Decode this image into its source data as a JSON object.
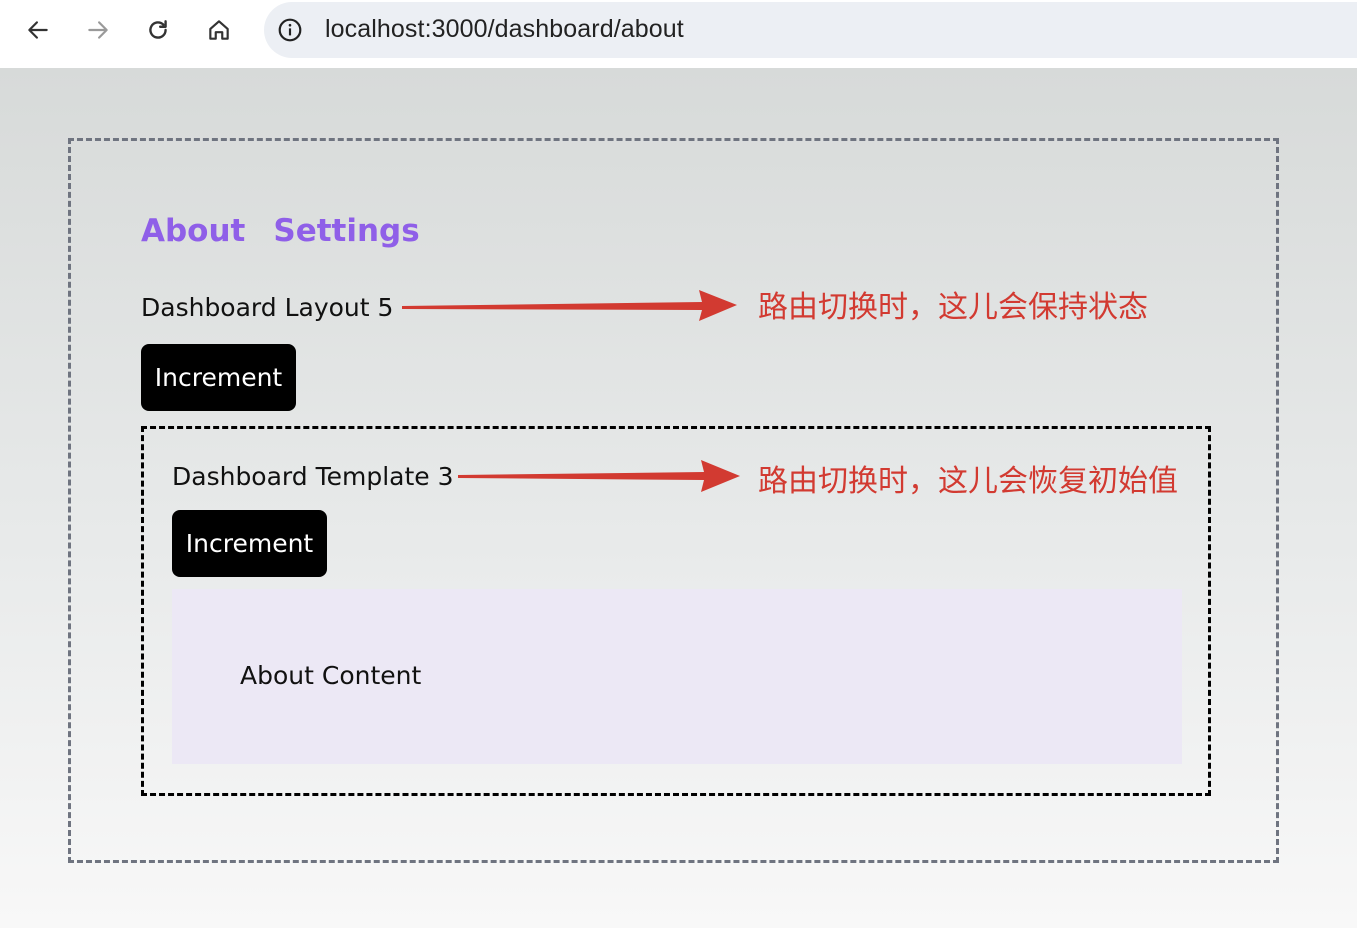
{
  "browser": {
    "url": "localhost:3000/dashboard/about",
    "icons": [
      "arrow-left-icon",
      "arrow-right-icon",
      "reload-icon",
      "home-icon",
      "info-icon"
    ]
  },
  "page": {
    "nav_links": [
      "About",
      "Settings"
    ],
    "layout": {
      "label": "Dashboard Layout 5",
      "button_label": "Increment"
    },
    "template": {
      "label": "Dashboard Template 3",
      "button_label": "Increment"
    },
    "content": {
      "text": "About Content"
    }
  },
  "annotations": {
    "layout_note": "路由切换时，这儿会保持状态",
    "template_note": "路由切换时，这儿会恢复初始值",
    "color": "#d23a31"
  },
  "colors": {
    "link": "#8f5fe8",
    "button_bg": "#000000",
    "content_bg": "#ece8f5"
  }
}
